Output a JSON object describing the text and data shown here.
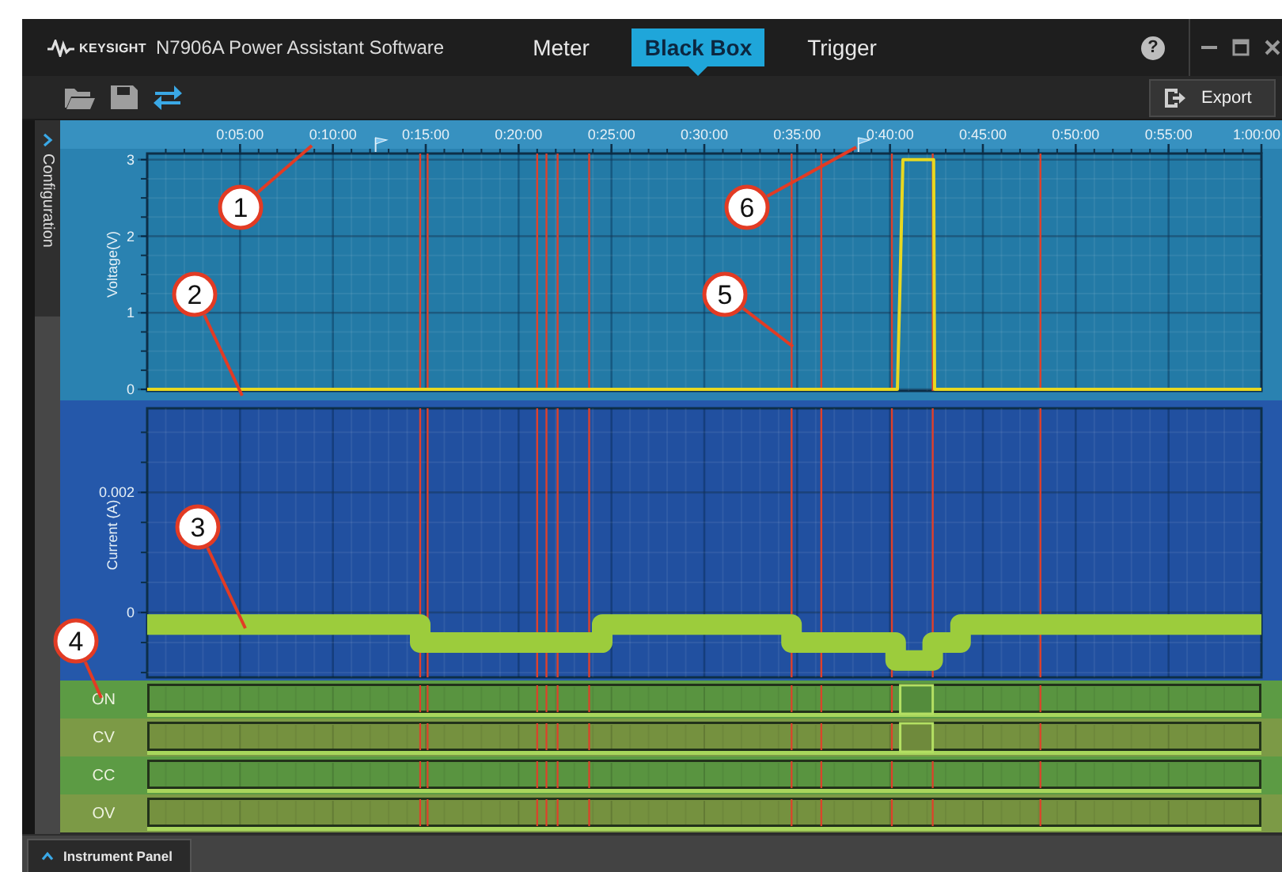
{
  "window": {
    "brand": "KEYSIGHT",
    "title": "N7906A Power Assistant Software",
    "help": "?"
  },
  "tabs": [
    {
      "label": "Meter",
      "selected": false
    },
    {
      "label": "Black Box",
      "selected": true
    },
    {
      "label": "Trigger",
      "selected": false
    }
  ],
  "toolbar": {
    "export_button": "Export"
  },
  "side_panel": {
    "label": "Configuration"
  },
  "voltage_chart": {
    "chart_data": {
      "type": "line",
      "ylabel": "Voltage(V)",
      "x": [
        0,
        40.4,
        40.55,
        40.7,
        42.35,
        42.4,
        60
      ],
      "series": [
        {
          "color": "#e8d820",
          "values": [
            0,
            0,
            1.5,
            3,
            3,
            0,
            0
          ]
        }
      ],
      "grid": true,
      "xlim": [
        0,
        60
      ],
      "ylim": [
        -0.02,
        3.08
      ],
      "xticks": [
        {
          "value": 5,
          "label": "0:05:00"
        },
        {
          "value": 10,
          "label": "0:10:00"
        },
        {
          "value": 15,
          "label": "0:15:00"
        },
        {
          "value": 20,
          "label": "0:20:00"
        },
        {
          "value": 25,
          "label": "0:25:00"
        },
        {
          "value": 30,
          "label": "0:30:00"
        },
        {
          "value": 35,
          "label": "0:35:00"
        },
        {
          "value": 40,
          "label": "0:40:00"
        },
        {
          "value": 45,
          "label": "0:45:00"
        },
        {
          "value": 50,
          "label": "0:50:00"
        },
        {
          "value": 55,
          "label": "0:55:00"
        },
        {
          "value": 60,
          "label": "1:00:00"
        }
      ],
      "yticks": [
        0,
        1,
        2,
        3
      ]
    }
  },
  "current_chart": {
    "chart_data": {
      "type": "line",
      "ylabel": "Current (A)",
      "x": [
        0,
        14.7,
        14.7,
        24.5,
        24.5,
        34.7,
        34.7,
        40.3,
        40.3,
        42.3,
        42.3,
        43.8,
        43.8,
        60
      ],
      "grid": true,
      "series": [
        {
          "color": "#9ccc3c",
          "values": [
            -0.0002,
            -0.0002,
            -0.0005,
            -0.0005,
            -0.0002,
            -0.0002,
            -0.0005,
            -0.0005,
            -0.0008,
            -0.0008,
            -0.0005,
            -0.0005,
            -0.0002,
            -0.0002
          ]
        }
      ],
      "xlim": [
        0,
        60
      ],
      "ylim": [
        -0.00108,
        0.0034
      ],
      "yticks": [
        0,
        0.002
      ]
    }
  },
  "status_signals": [
    {
      "name": "ON",
      "pulsed": true
    },
    {
      "name": "CV",
      "pulsed": true
    },
    {
      "name": "CC",
      "pulsed": false
    },
    {
      "name": "OV",
      "pulsed": false
    }
  ],
  "callouts": [
    {
      "label": "1"
    },
    {
      "label": "2"
    },
    {
      "label": "3"
    },
    {
      "label": "4"
    },
    {
      "label": "5"
    },
    {
      "label": "6"
    }
  ],
  "bottom_panel": {
    "label": "Instrument Panel"
  }
}
